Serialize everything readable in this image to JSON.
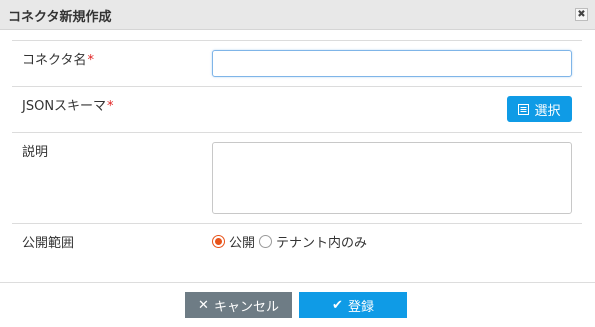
{
  "dialog": {
    "title": "コネクタ新規作成",
    "close_symbol": "✖"
  },
  "form": {
    "connector_name": {
      "label": "コネクタ名",
      "required_mark": "*",
      "value": ""
    },
    "json_schema": {
      "label": "JSONスキーマ",
      "required_mark": "*",
      "select_button_label": "選択",
      "select_button_icon": "list-icon"
    },
    "description": {
      "label": "説明",
      "value": ""
    },
    "visibility": {
      "label": "公開範囲",
      "options": [
        "公開",
        "テナント内のみ"
      ],
      "selected": "公開"
    }
  },
  "footer": {
    "cancel_label": "キャンセル",
    "cancel_icon": "close-icon",
    "register_label": "登録",
    "register_icon": "checkmark-icon"
  },
  "colors": {
    "primary": "#0f9be6",
    "cancel": "#6e7c85",
    "required": "#e02020",
    "radio_selected": "#e8531a",
    "titlebar": "#e8e8e8"
  }
}
